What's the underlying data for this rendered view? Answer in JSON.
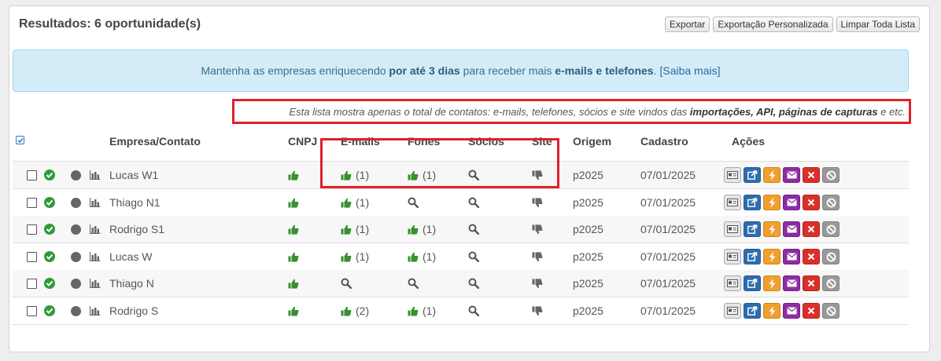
{
  "header": {
    "title": "Resultados: 6 oportunidade(s)",
    "buttons": [
      "Exportar",
      "Exportação Personalizada",
      "Limpar Toda Lista"
    ]
  },
  "info": {
    "part1": "Mantenha as empresas enriquecendo ",
    "bold1": "por até 3 dias",
    "part2": " para receber mais ",
    "bold2": "e-mails e telefones",
    "part3": ".",
    "link": "[Saiba mais]"
  },
  "note": {
    "part1": "Esta lista mostra apenas o total de contatos: e-mails, telefones, sócios e site vindos das ",
    "bold": "importações, API, páginas de capturas",
    "part2": " e etc."
  },
  "columns": [
    "Empresa/Contato",
    "CNPJ",
    "E-mails",
    "Fones",
    "Sócios",
    "Site",
    "Origem",
    "Cadastro",
    "Ações"
  ],
  "rows": [
    {
      "name": "Lucas W1",
      "cnpj": "thumbs-up",
      "emails": "thumbs-up",
      "emails_count": "(1)",
      "fones": "thumbs-up",
      "fones_count": "(1)",
      "socios": "search",
      "site": "thumbs-down",
      "origem": "p2025",
      "cadastro": "07/01/2025"
    },
    {
      "name": "Thiago N1",
      "cnpj": "thumbs-up",
      "emails": "thumbs-up",
      "emails_count": "(1)",
      "fones": "search",
      "fones_count": "",
      "socios": "search",
      "site": "thumbs-down",
      "origem": "p2025",
      "cadastro": "07/01/2025"
    },
    {
      "name": "Rodrigo S1",
      "cnpj": "thumbs-up",
      "emails": "thumbs-up",
      "emails_count": "(1)",
      "fones": "thumbs-up",
      "fones_count": "(1)",
      "socios": "search",
      "site": "thumbs-down",
      "origem": "p2025",
      "cadastro": "07/01/2025"
    },
    {
      "name": "Lucas W",
      "cnpj": "thumbs-up",
      "emails": "thumbs-up",
      "emails_count": "(1)",
      "fones": "thumbs-up",
      "fones_count": "(1)",
      "socios": "search",
      "site": "thumbs-down",
      "origem": "p2025",
      "cadastro": "07/01/2025"
    },
    {
      "name": "Thiago N",
      "cnpj": "thumbs-up",
      "emails": "search",
      "emails_count": "",
      "fones": "search",
      "fones_count": "",
      "socios": "search",
      "site": "thumbs-down",
      "origem": "p2025",
      "cadastro": "07/01/2025"
    },
    {
      "name": "Rodrigo S",
      "cnpj": "thumbs-up",
      "emails": "thumbs-up",
      "emails_count": "(2)",
      "fones": "thumbs-up",
      "fones_count": "(1)",
      "socios": "search",
      "site": "thumbs-down",
      "origem": "p2025",
      "cadastro": "07/01/2025"
    }
  ],
  "actions": [
    "id-card-icon",
    "share-icon",
    "bolt-icon",
    "envelope-icon",
    "delete-icon",
    "ban-icon"
  ],
  "colors": {
    "accent": "#2e9b3a",
    "highlight": "#e0202b",
    "info_bg": "#d3ecf8"
  }
}
